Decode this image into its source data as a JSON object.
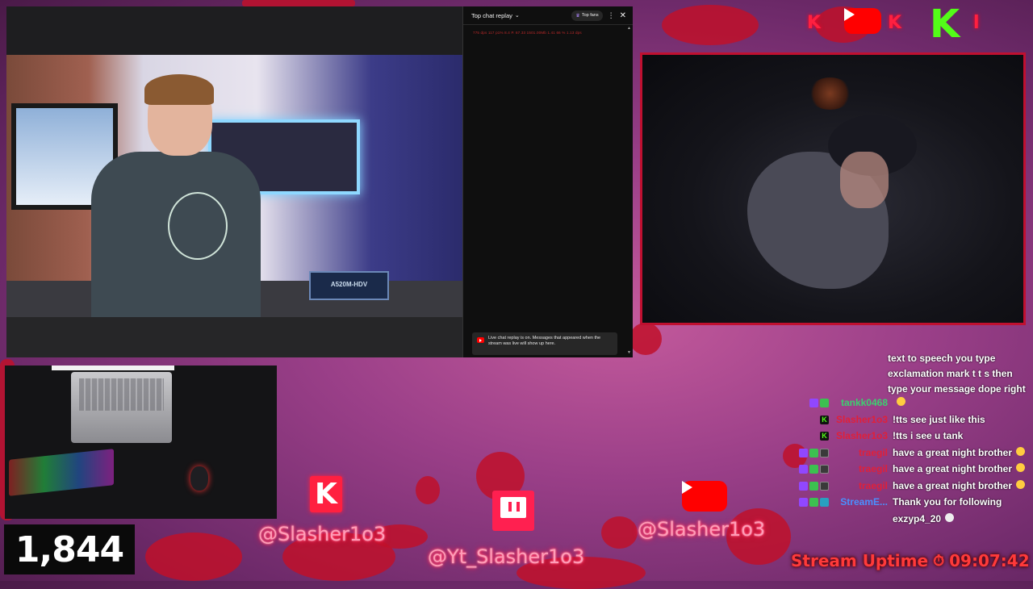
{
  "video": {
    "board_label": "A520M-HDV"
  },
  "chat_replay": {
    "title": "Top chat replay",
    "top_fans_label": "Top fans",
    "stats_text": "775 dps   117 p1% 8.4 P. 67.33 1501.00Mb   1.41 66 %   1.13 dps",
    "notice_text": "Live chat replay is on. Messages that appeared when the stream was live will show up here."
  },
  "viewer_count": "1,844",
  "socials": {
    "kick_handle": "@Slasher1o3",
    "twitch_handle": "@Yt_Slasher1o3",
    "youtube_handle": "@Slasher1o3"
  },
  "uptime": {
    "label": "Stream Uptime",
    "time": "09:07:42"
  },
  "stream_chat": {
    "tts_text": [
      "text to speech you type",
      "exclamation mark t t s then",
      "type your message dope right"
    ],
    "messages": [
      {
        "user": "tankk0468",
        "color": "#3cd070",
        "text": "",
        "badges": [
          "tw",
          "check"
        ],
        "emote": "smile"
      },
      {
        "user": "Slasher1o3",
        "color": "#e0203a",
        "text": "!tts see just like this",
        "badges": [
          "k"
        ],
        "emote": ""
      },
      {
        "user": "Slasher1o3",
        "color": "#e0203a",
        "text": "!tts i see u tank",
        "badges": [
          "k"
        ],
        "emote": ""
      },
      {
        "user": "traegil",
        "color": "#e0203a",
        "text": "have a great night brother",
        "badges": [
          "tw",
          "check",
          "mute"
        ],
        "emote": "smile"
      },
      {
        "user": "traegil",
        "color": "#e0203a",
        "text": "have a great night brother",
        "badges": [
          "tw",
          "check",
          "mute"
        ],
        "emote": "smile"
      },
      {
        "user": "traegil",
        "color": "#e0203a",
        "text": "have a great night brother",
        "badges": [
          "tw",
          "check",
          "mute"
        ],
        "emote": "smile"
      },
      {
        "user": "StreamE...",
        "color": "#4a90ff",
        "text": "Thank you for following",
        "badges": [
          "tw",
          "check",
          "bot"
        ],
        "emote": ""
      },
      {
        "user": "",
        "color": "#ffffff",
        "text": "exzyp4_20",
        "badges": [],
        "emote": "skull"
      }
    ]
  },
  "colors": {
    "accent_red": "#c01030",
    "kick_green": "#53fc18",
    "youtube_red": "#ff0000",
    "twitch_purple": "#9147ff"
  }
}
